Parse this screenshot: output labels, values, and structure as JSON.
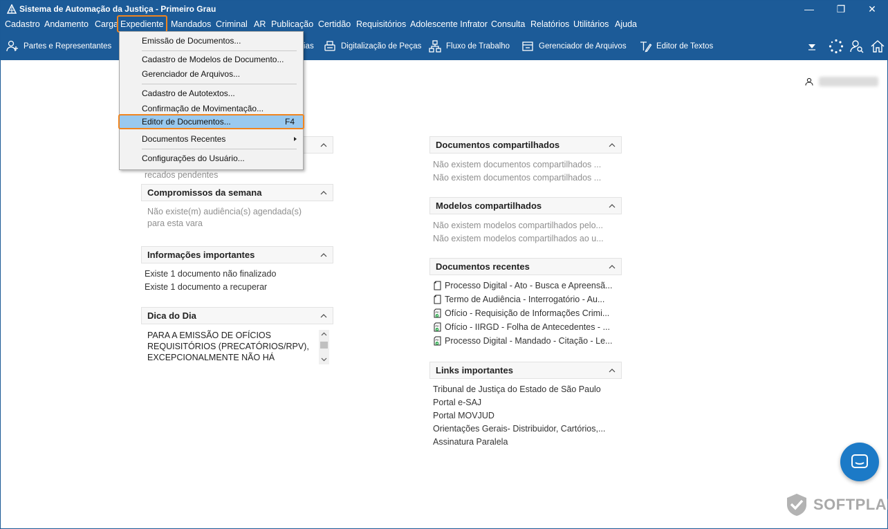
{
  "window": {
    "title": "Sistema de Automação da Justiça - Primeiro Grau",
    "controls": {
      "minimize": "—",
      "restore": "❐",
      "close": "✕"
    }
  },
  "menubar": {
    "items": [
      {
        "label": "Cadastro"
      },
      {
        "label": "Andamento"
      },
      {
        "label": "Carga"
      },
      {
        "label": "Expediente"
      },
      {
        "label": "Mandados"
      },
      {
        "label": "Criminal"
      },
      {
        "label": "AR"
      },
      {
        "label": "Publicação"
      },
      {
        "label": "Certidão"
      },
      {
        "label": "Requisitórios"
      },
      {
        "label": "Adolescente Infrator"
      },
      {
        "label": "Consulta"
      },
      {
        "label": "Relatórios"
      },
      {
        "label": "Utilitários"
      },
      {
        "label": "Ajuda"
      }
    ]
  },
  "toolbar": {
    "partes": "Partes e Representantes",
    "obscured_label": "ias",
    "digitalizacao": "Digitalização de Peças",
    "fluxo": "Fluxo de Trabalho",
    "gerenciador": "Gerenciador de Arquivos",
    "editor": "Editor de Textos"
  },
  "dropdown": {
    "items": [
      {
        "label": "Emissão de Documentos..."
      },
      {
        "label": "Cadastro de Modelos de Documento..."
      },
      {
        "label": "Gerenciador de Arquivos..."
      },
      {
        "label": "Cadastro de Autotextos..."
      },
      {
        "label": "Confirmação de Movimentação..."
      },
      {
        "label": "Editor de Documentos...",
        "shortcut": "F4"
      },
      {
        "label": "Documentos Recentes"
      },
      {
        "label": "Configurações do Usuário..."
      }
    ]
  },
  "user": {
    "name": ""
  },
  "left_panels": {
    "recados_text": "recados pendentes",
    "compromissos": {
      "title": "Compromissos da semana",
      "line1": "Não existe(m) audiência(s) agendada(s)",
      "line2": "para esta vara"
    },
    "informacoes": {
      "title": "Informações importantes",
      "line1": "Existe 1 documento não finalizado",
      "line2": "Existe 1 documento a recuperar"
    },
    "dica": {
      "title": "Dica do Dia",
      "text": "PARA A EMISSÃO DE OFÍCIOS REQUISITÓRIOS (PRECATÓRIOS/RPV), EXCEPCIONALMENTE NÃO HÁ"
    }
  },
  "right_panels": {
    "compartilhados": {
      "title": "Documentos compartilhados",
      "line1": "Não existem documentos compartilhados ...",
      "line2": "Não existem documentos compartilhados ..."
    },
    "modelos": {
      "title": "Modelos compartilhados",
      "line1": "Não existem modelos compartilhados pelo...",
      "line2": "Não existem modelos compartilhados ao u..."
    },
    "recentes": {
      "title": "Documentos recentes",
      "items": [
        {
          "label": "Processo Digital - Ato - Busca e Apreensã...",
          "icon": "document-icon"
        },
        {
          "label": "Termo de Audiência - Interrogatório - Au...",
          "icon": "document-icon"
        },
        {
          "label": "Ofício - Requisição de Informações Crimi...",
          "icon": "signed-document-icon"
        },
        {
          "label": "Ofício - IIRGD - Folha de Antecedentes - ...",
          "icon": "signed-document-icon"
        },
        {
          "label": "Processo Digital - Mandado - Citação - Le...",
          "icon": "signed-document-icon"
        }
      ]
    },
    "links": {
      "title": "Links importantes",
      "items": [
        {
          "label": "Tribunal de Justiça do Estado de São Paulo"
        },
        {
          "label": "Portal e-SAJ"
        },
        {
          "label": "Portal MOVJUD"
        },
        {
          "label": "Orientações Gerais- Distribuidor, Cartórios,..."
        },
        {
          "label": "Assinatura Paralela"
        }
      ]
    }
  },
  "brand": {
    "name": "SOFTPLAN"
  },
  "colors": {
    "accent": "#1c5b98",
    "highlight": "#f0841e",
    "selection": "#99c9ef",
    "chat": "#1c7ac7"
  }
}
